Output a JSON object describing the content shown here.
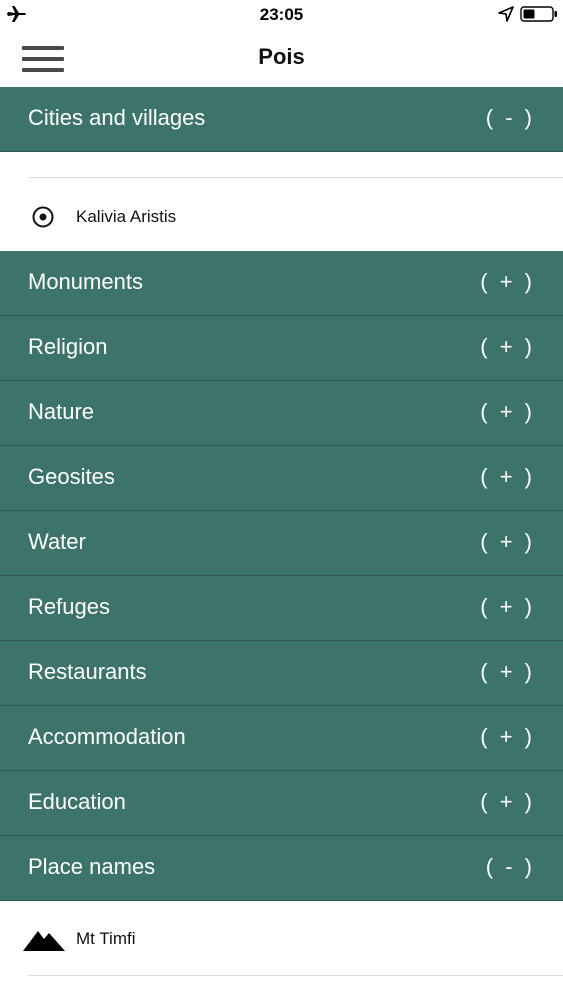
{
  "status_bar": {
    "time": "23:05",
    "icons": [
      "airplane-icon",
      "location-arrow-icon",
      "battery-icon"
    ]
  },
  "nav": {
    "title": "Pois",
    "menu_icon": "hamburger-menu-icon"
  },
  "colors": {
    "category_bg": "#3c736b",
    "category_text": "#ffffff",
    "item_text": "#111111"
  },
  "categories": [
    {
      "label": "Cities and villages",
      "toggle": "( - )",
      "expanded": true,
      "items": [
        {
          "label": "Kalivia Aristis",
          "icon": "target-circle-icon"
        }
      ]
    },
    {
      "label": "Monuments",
      "toggle": "( + )",
      "expanded": false
    },
    {
      "label": "Religion",
      "toggle": "( + )",
      "expanded": false
    },
    {
      "label": "Nature",
      "toggle": "( + )",
      "expanded": false
    },
    {
      "label": "Geosites",
      "toggle": "( + )",
      "expanded": false
    },
    {
      "label": "Water",
      "toggle": "( + )",
      "expanded": false
    },
    {
      "label": "Refuges",
      "toggle": "( + )",
      "expanded": false
    },
    {
      "label": "Restaurants",
      "toggle": "( + )",
      "expanded": false
    },
    {
      "label": "Accommodation",
      "toggle": "( + )",
      "expanded": false
    },
    {
      "label": "Education",
      "toggle": "( + )",
      "expanded": false
    },
    {
      "label": "Place names",
      "toggle": "( - )",
      "expanded": true,
      "items": [
        {
          "label": "Mt Timfi",
          "icon": "mountain-icon"
        }
      ]
    }
  ]
}
